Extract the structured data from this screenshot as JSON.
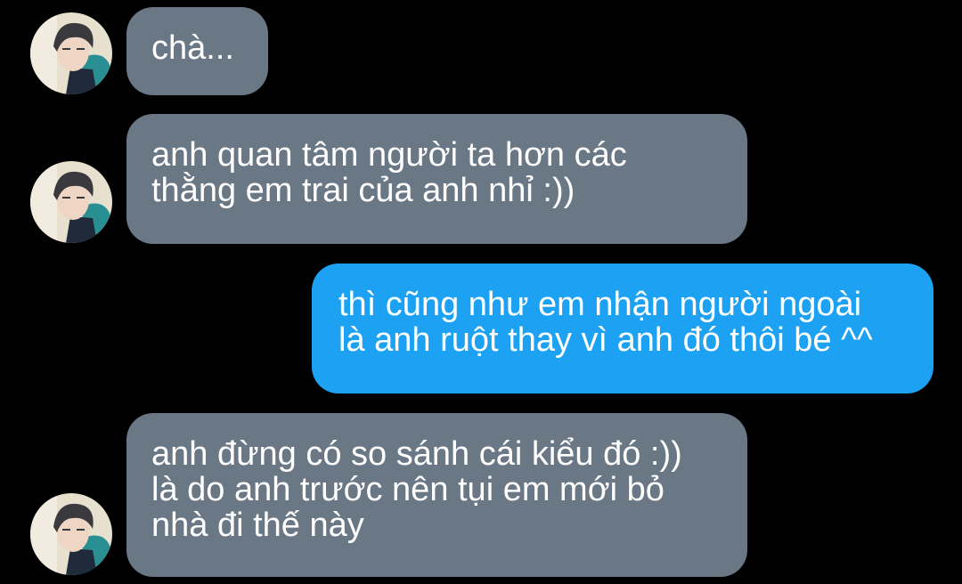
{
  "colors": {
    "background": "#000000",
    "incoming_bubble": "#6a7785",
    "outgoing_bubble": "#1da1f2",
    "text": "#ffffff"
  },
  "messages": [
    {
      "direction": "incoming",
      "has_avatar": true,
      "lines": [
        "chà..."
      ]
    },
    {
      "direction": "incoming",
      "has_avatar": true,
      "lines": [
        "anh quan tâm người ta hơn các",
        "thằng em trai của anh nhỉ :))"
      ]
    },
    {
      "direction": "outgoing",
      "has_avatar": false,
      "lines": [
        "thì cũng như em nhận người ngoài",
        "là anh ruột thay vì anh đó thôi bé ^^"
      ]
    },
    {
      "direction": "incoming",
      "has_avatar": true,
      "lines": [
        "anh đừng có so sánh cái kiểu đó :))",
        "là do anh trước nên tụi em mới bỏ",
        "nhà đi thế này"
      ]
    }
  ]
}
